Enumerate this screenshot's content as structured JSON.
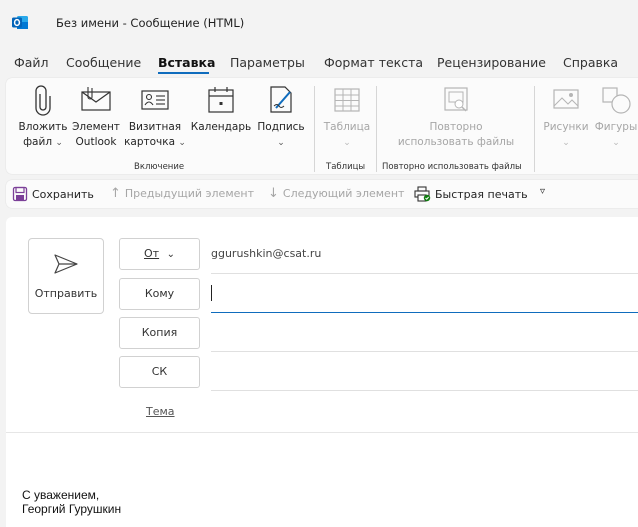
{
  "window": {
    "title": "Без имени  -  Сообщение (HTML)"
  },
  "menu": {
    "tabs": [
      {
        "label": "Файл"
      },
      {
        "label": "Сообщение"
      },
      {
        "label": "Вставка"
      },
      {
        "label": "Параметры"
      },
      {
        "label": "Формат текста"
      },
      {
        "label": "Рецензирование"
      },
      {
        "label": "Справка"
      }
    ],
    "active": "Вставка"
  },
  "ribbon": {
    "attach": {
      "line1": "Вложить",
      "line2": "файл"
    },
    "outlook_item": {
      "line1": "Элемент",
      "line2": "Outlook"
    },
    "business_card": {
      "line1": "Визитная",
      "line2": "карточка"
    },
    "calendar": {
      "line1": "Календарь"
    },
    "signature": {
      "line1": "Подпись"
    },
    "table": {
      "line1": "Таблица"
    },
    "reuse": {
      "line1": "Повторно",
      "line2": "использовать файлы"
    },
    "pictures": {
      "line1": "Рисунки"
    },
    "shapes": {
      "line1": "Фигуры"
    },
    "groups": {
      "include": "Включение",
      "tables": "Таблицы",
      "reuse": "Повторно использовать файлы"
    }
  },
  "quickbar": {
    "save": "Сохранить",
    "previous": "Предыдущий элемент",
    "next": "Следующий элемент",
    "quick_print": "Быстрая печать"
  },
  "compose": {
    "send_label": "Отправить",
    "from_label": "От",
    "from_value": "ggurushkin@csat.ru",
    "to_label": "Кому",
    "cc_label": "Копия",
    "bcc_label": "СК",
    "subject_label": "Тема",
    "signature_line1": "С уважением,",
    "signature_line2": "Георгий Гурушкин"
  },
  "colors": {
    "accent": "#0f6cbd",
    "outlook_blue": "#0364b8"
  },
  "icons": {
    "app": "outlook-icon",
    "send": "send-icon",
    "save": "save-icon",
    "print": "quick-print-icon"
  }
}
